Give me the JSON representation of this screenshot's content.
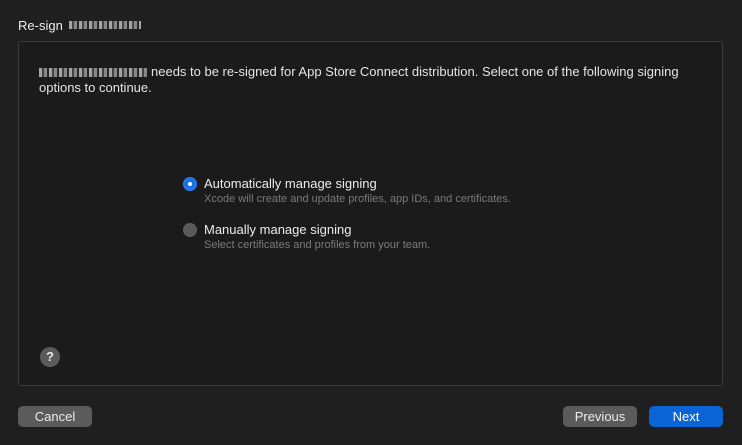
{
  "window": {
    "title_prefix": "Re-sign"
  },
  "description": {
    "text": "needs to be re-signed for App Store Connect distribution. Select one of the following signing options to continue."
  },
  "options": [
    {
      "label": "Automatically manage signing",
      "description": "Xcode will create and update profiles, app IDs, and certificates.",
      "selected": true
    },
    {
      "label": "Manually manage signing",
      "description": "Select certificates and profiles from your team.",
      "selected": false
    }
  ],
  "help": {
    "glyph": "?"
  },
  "buttons": {
    "cancel": "Cancel",
    "previous": "Previous",
    "next": "Next"
  },
  "colors": {
    "accent": "#0a64d6",
    "background": "#1f1f1f",
    "button_gray": "#5b5b5b"
  }
}
